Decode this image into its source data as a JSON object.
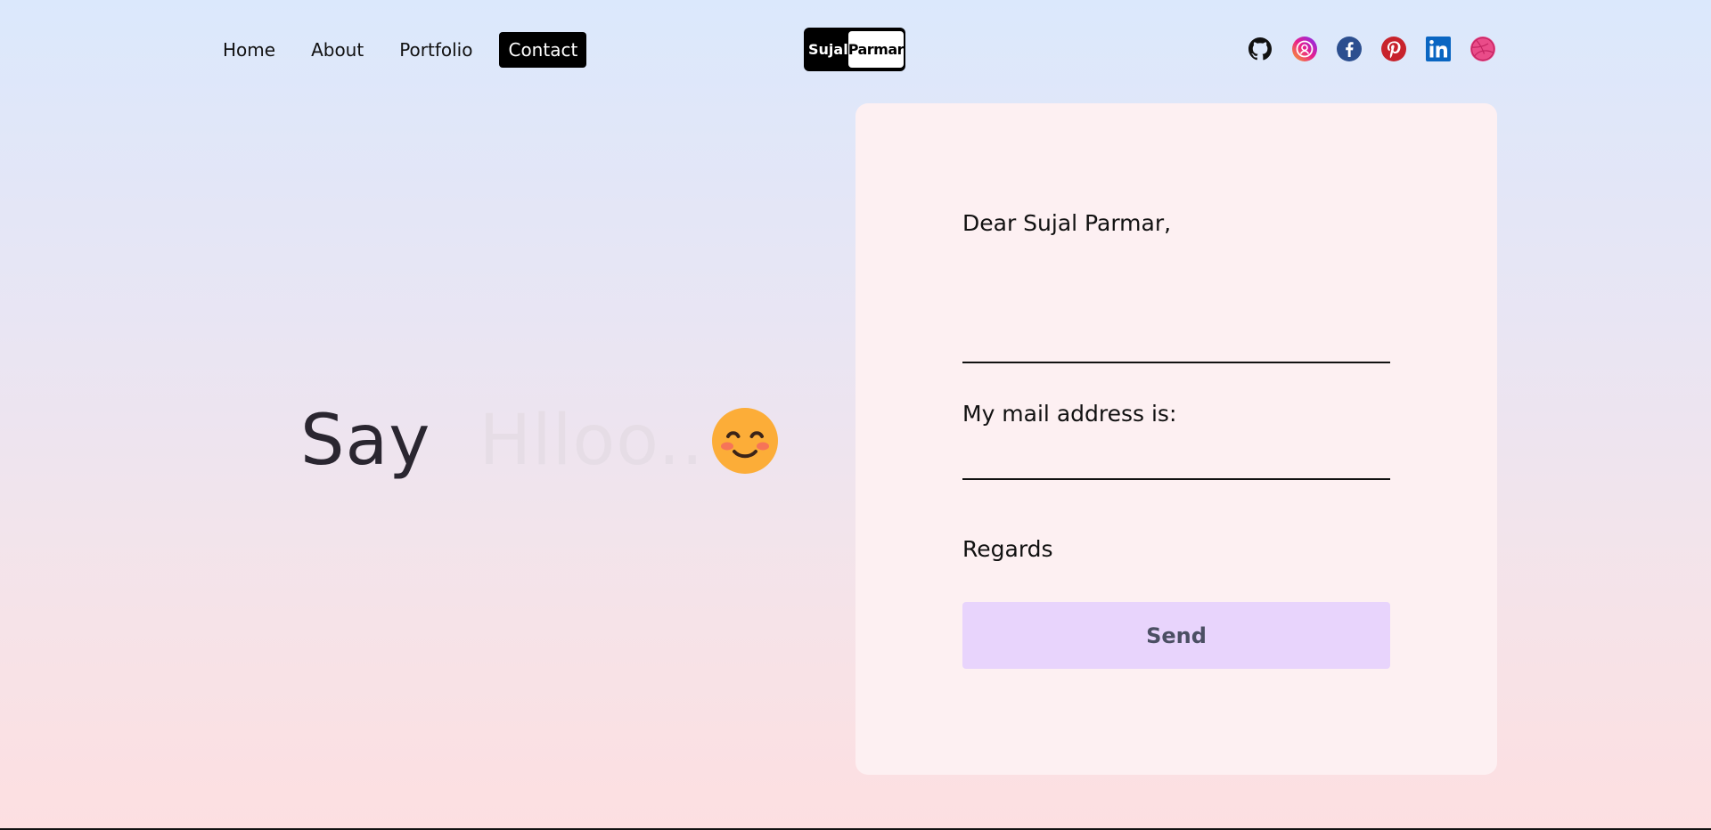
{
  "nav": {
    "items": [
      {
        "label": "Home",
        "active": false
      },
      {
        "label": "About",
        "active": false
      },
      {
        "label": "Portfolio",
        "active": false
      },
      {
        "label": "Contact",
        "active": true
      }
    ]
  },
  "logo": {
    "first": "Sujal",
    "last": "Parmar"
  },
  "socials": [
    {
      "icon": "github-icon",
      "color": "#111111"
    },
    {
      "icon": "threads-icon",
      "color": "#c13bd8"
    },
    {
      "icon": "facebook-icon",
      "color": "#2c4f8f"
    },
    {
      "icon": "pinterest-icon",
      "color": "#c8232c"
    },
    {
      "icon": "linkedin-icon",
      "color": "#0a66c2"
    },
    {
      "icon": "dribbble-icon",
      "color": "#ea4c89"
    }
  ],
  "hero": {
    "say": "Say",
    "hello": "Hlloo..",
    "emoji": "smiling-face-emoji"
  },
  "form": {
    "greeting": "Dear Sujal Parmar,",
    "message_value": "",
    "mail_label": "My mail address is:",
    "mail_value": "",
    "regards": "Regards",
    "send_label": "Send"
  },
  "colors": {
    "send_bg": "#e8d4fc",
    "card_bg": "#fdf0f2"
  }
}
